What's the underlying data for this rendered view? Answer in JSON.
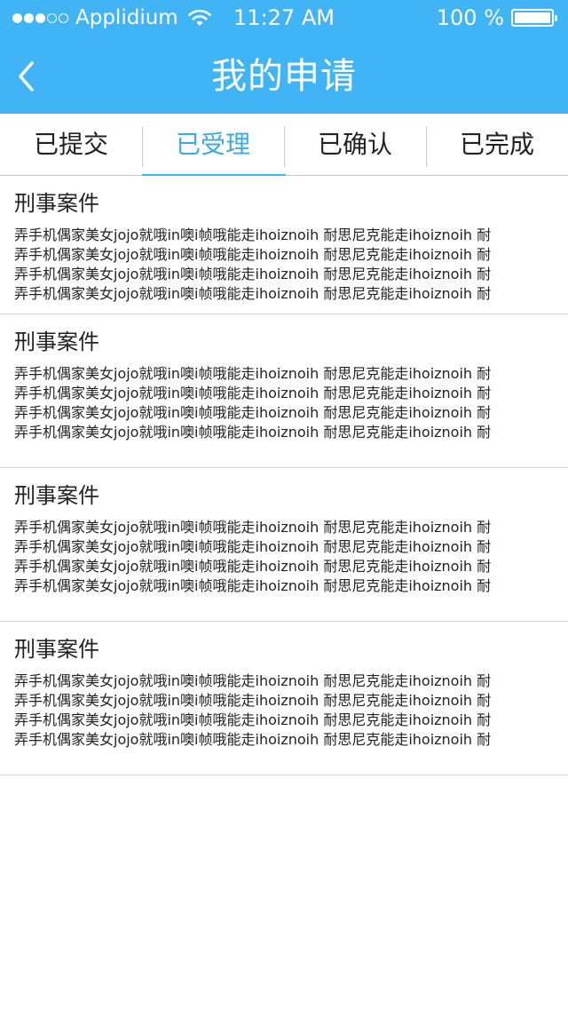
{
  "status_bar": {
    "carrier": "Applidium",
    "time": "11:27 AM",
    "battery": "100 %",
    "battery_level": 1.0,
    "signal_bars": 3
  },
  "nav": {
    "title": "我的申请",
    "back_icon": "chevron-left-icon"
  },
  "tabs": [
    {
      "label": "已提交",
      "active": false
    },
    {
      "label": "已受理",
      "active": true
    },
    {
      "label": "已确认",
      "active": false
    },
    {
      "label": "已完成",
      "active": false
    }
  ],
  "items": [
    {
      "title": "刑事案件",
      "lines": [
        "弄手机偶家美女jojo就哦in噢i帧哦能走ihoiznoih 耐思尼克能走ihoiznoih 耐",
        "弄手机偶家美女jojo就哦in噢i帧哦能走ihoiznoih 耐思尼克能走ihoiznoih 耐",
        "弄手机偶家美女jojo就哦in噢i帧哦能走ihoiznoih 耐思尼克能走ihoiznoih 耐",
        "弄手机偶家美女jojo就哦in噢i帧哦能走ihoiznoih 耐思尼克能走ihoiznoih 耐"
      ]
    },
    {
      "title": "刑事案件",
      "lines": [
        "弄手机偶家美女jojo就哦in噢i帧哦能走ihoiznoih 耐思尼克能走ihoiznoih 耐",
        "弄手机偶家美女jojo就哦in噢i帧哦能走ihoiznoih 耐思尼克能走ihoiznoih 耐",
        "弄手机偶家美女jojo就哦in噢i帧哦能走ihoiznoih 耐思尼克能走ihoiznoih 耐",
        "弄手机偶家美女jojo就哦in噢i帧哦能走ihoiznoih 耐思尼克能走ihoiznoih 耐"
      ]
    },
    {
      "title": "刑事案件",
      "lines": [
        "弄手机偶家美女jojo就哦in噢i帧哦能走ihoiznoih 耐思尼克能走ihoiznoih 耐",
        "弄手机偶家美女jojo就哦in噢i帧哦能走ihoiznoih 耐思尼克能走ihoiznoih 耐",
        "弄手机偶家美女jojo就哦in噢i帧哦能走ihoiznoih 耐思尼克能走ihoiznoih 耐",
        "弄手机偶家美女jojo就哦in噢i帧哦能走ihoiznoih 耐思尼克能走ihoiznoih 耐"
      ]
    },
    {
      "title": "刑事案件",
      "lines": [
        "弄手机偶家美女jojo就哦in噢i帧哦能走ihoiznoih 耐思尼克能走ihoiznoih 耐",
        "弄手机偶家美女jojo就哦in噢i帧哦能走ihoiznoih 耐思尼克能走ihoiznoih 耐",
        "弄手机偶家美女jojo就哦in噢i帧哦能走ihoiznoih 耐思尼克能走ihoiznoih 耐",
        "弄手机偶家美女jojo就哦in噢i帧哦能走ihoiznoih 耐思尼克能走ihoiznoih 耐"
      ]
    }
  ],
  "colors": {
    "header_bg": "#40b4f4",
    "active_tab": "#3aa9e6",
    "text": "#222222",
    "divider": "#d4d4d4"
  }
}
